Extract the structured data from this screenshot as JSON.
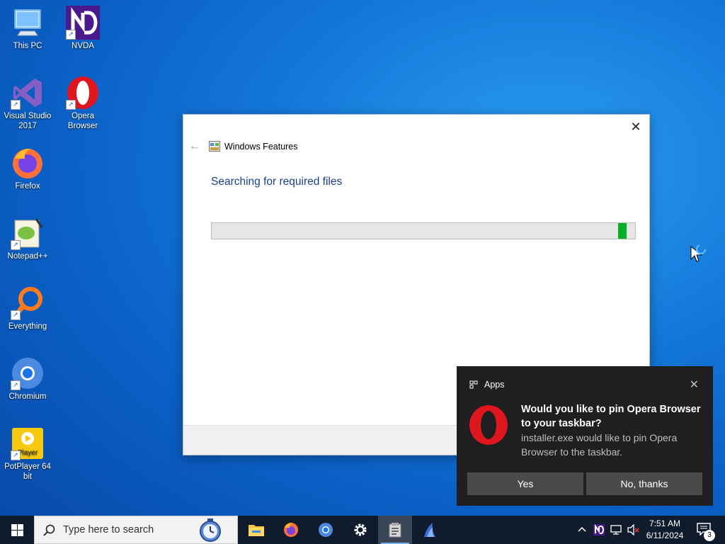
{
  "desktop": {
    "icons": [
      {
        "label": "This PC",
        "icon": "computer-icon"
      },
      {
        "label": "NVDA",
        "icon": "nvda-icon"
      },
      {
        "label": "Visual Studio 2017",
        "icon": "visual-studio-icon"
      },
      {
        "label": "Opera Browser",
        "icon": "opera-icon"
      },
      {
        "label": "Firefox",
        "icon": "firefox-icon"
      },
      {
        "label": "Notepad++",
        "icon": "notepadpp-icon"
      },
      {
        "label": "Everything",
        "icon": "everything-icon"
      },
      {
        "label": "Chromium",
        "icon": "chromium-icon"
      },
      {
        "label": "PotPlayer 64 bit",
        "icon": "potplayer-icon"
      }
    ],
    "potplayer_logo_text": "Player"
  },
  "dialog": {
    "title": "Windows Features",
    "heading": "Searching for required files",
    "progress_percent": 98
  },
  "toast": {
    "app_name": "Apps",
    "headline": "Would you like to pin Opera Browser to your taskbar?",
    "body": "installer.exe would like to pin Opera Browser to the taskbar.",
    "yes_label": "Yes",
    "no_label": "No, thanks"
  },
  "taskbar": {
    "search_placeholder": "Type here to search",
    "apps": [
      "file-explorer-icon",
      "firefox-icon",
      "chromium-icon",
      "settings-icon",
      "windows-features-icon",
      "installer-icon"
    ],
    "time": "7:51 AM",
    "date": "6/11/2024",
    "notification_count": "3"
  },
  "colors": {
    "accent_blue": "#1a3f8c",
    "progress_green": "#06b025",
    "toast_bg": "#1f1f1f",
    "opera_red": "#e0161f"
  }
}
